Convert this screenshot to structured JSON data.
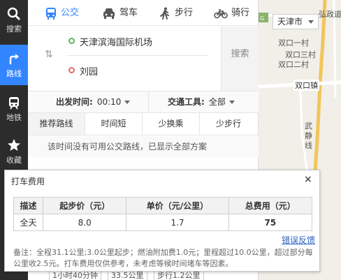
{
  "nav": {
    "items": [
      {
        "label": "搜索",
        "icon": "search-icon"
      },
      {
        "label": "路线",
        "icon": "route-icon",
        "active": true
      },
      {
        "label": "地铁",
        "icon": "subway-icon"
      },
      {
        "label": "收藏",
        "icon": "star-icon"
      }
    ]
  },
  "mode_tabs": [
    {
      "label": "公交",
      "icon": "bus-icon",
      "active": true
    },
    {
      "label": "驾车",
      "icon": "car-icon"
    },
    {
      "label": "步行",
      "icon": "walk-icon"
    },
    {
      "label": "骑行",
      "icon": "bike-icon"
    }
  ],
  "route": {
    "start": "天津滨海国际机场",
    "end": "刘园",
    "search_label": "搜索"
  },
  "filters": {
    "depart_label": "出发时间:",
    "depart_value": "00:10",
    "tool_label": "交通工具:",
    "tool_value": "全部"
  },
  "prefs": [
    "推荐路线",
    "时间短",
    "少换乘",
    "少步行"
  ],
  "notice": "该时间没有可用公交路线，已显示全部方案",
  "bottom_peek": {
    "duration": "1小时40分钟",
    "distance": "33.5公里",
    "walk": "步行1.2公里"
  },
  "map": {
    "city": "天津市",
    "labels": [
      "双口一村",
      "双口三村",
      "双口二村",
      "双口镇",
      "弘政道",
      "武",
      "静",
      "线"
    ],
    "accent_road": "#f2c55c"
  },
  "popup": {
    "title": "打车费用",
    "close": "×",
    "headers": [
      "描述",
      "起步价（元）",
      "单价（元/公里）",
      "总费用（元）"
    ],
    "row": [
      "全天",
      "8.0",
      "1.7",
      "75"
    ],
    "report": "错误反馈",
    "note": "备注：全程31.1公里;3.0公里起步；燃油附加费1.0元；里程超过10.0公里，超过部分每公里收2.5元。打车费用仅供参考，未考虑等候时间堵车等因素。"
  },
  "colors": {
    "accent": "#3385ff",
    "nav_bg": "#2c2c2c",
    "start_dot": "#5bb55b",
    "end_dot": "#e26a6a",
    "link": "#2b62c4"
  }
}
